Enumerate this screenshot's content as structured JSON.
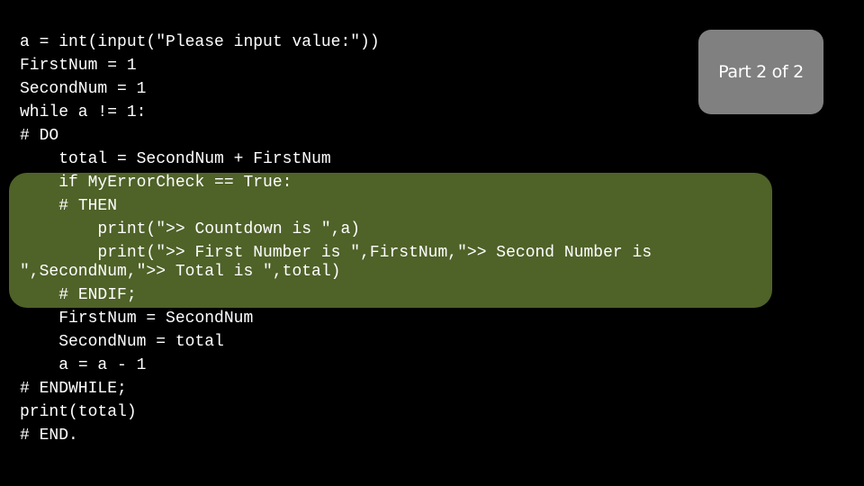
{
  "slide": {
    "badge_label": "Part 2 of 2",
    "colors": {
      "background": "#000000",
      "highlight": "#4f6228",
      "badge": "#808080",
      "text": "#ffffff"
    },
    "code_lines": [
      "a = int(input(\"Please input value:\"))",
      "FirstNum = 1",
      "SecondNum = 1",
      "while a != 1:",
      "# DO",
      "    total = SecondNum + FirstNum",
      "    if MyErrorCheck == True:",
      "    # THEN",
      "        print(\">> Countdown is \",a)",
      "        print(\">> First Number is \",FirstNum,\">> Second Number is \",SecondNum,\">> Total is \",total)",
      "    # ENDIF;",
      "    FirstNum = SecondNum",
      "    SecondNum = total",
      "    a = a - 1",
      "# ENDWHILE;",
      "print(total)",
      "# END."
    ],
    "highlighted_lines": "6-10"
  }
}
